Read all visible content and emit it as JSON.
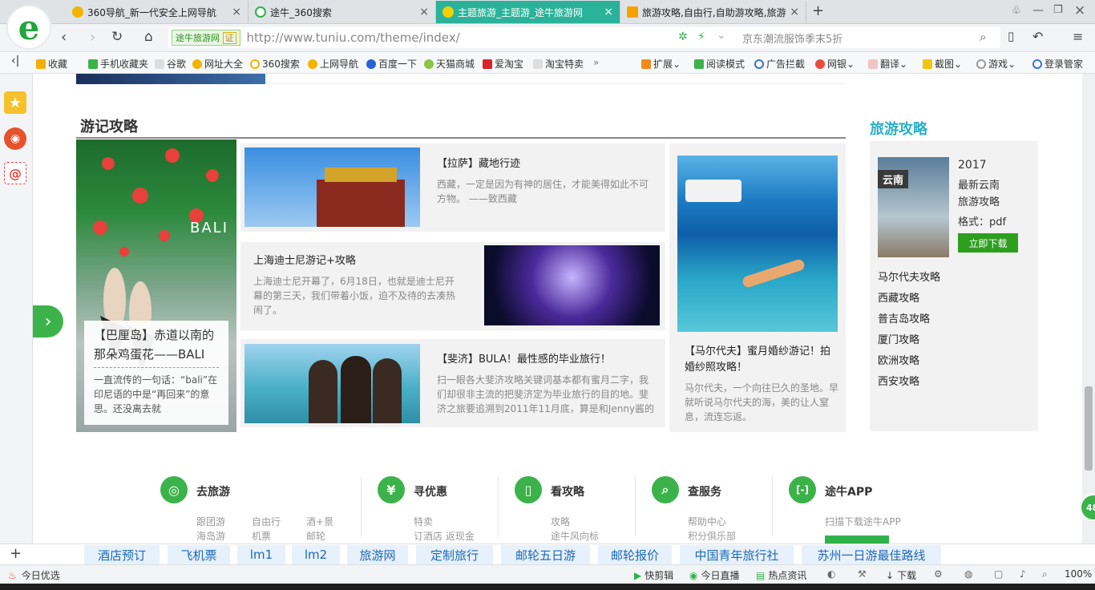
{
  "tabs": [
    {
      "label": "360导航_新一代安全上网导航",
      "color": "#f2b400"
    },
    {
      "label": "途牛_360搜索",
      "color": "#2fb24a"
    },
    {
      "label": "主题旅游_主题游_途牛旅游网",
      "color": "#f5d000"
    },
    {
      "label": "旅游攻略,自由行,自助游攻略,旅游",
      "color": "#f5a200"
    }
  ],
  "toolbar": {
    "site_badge": "途牛旅游网",
    "cert": "证",
    "url": "http://www.tuniu.com/theme/index/",
    "search_hint": "京东潮流服饰季末5折"
  },
  "bookmarks": {
    "left": [
      "收藏",
      "手机收藏夹",
      "谷歌",
      "网址大全",
      "360搜索",
      "上网导航",
      "百度一下",
      "天猫商城",
      "爱淘宝",
      "淘宝特卖"
    ],
    "more": "»",
    "right": [
      "扩展",
      "阅读模式",
      "广告拦截",
      "网银",
      "翻译",
      "截图",
      "游戏",
      "登录管家"
    ]
  },
  "section": {
    "title": "游记攻略"
  },
  "feature": {
    "title": "【巴厘岛】赤道以南的那朵鸡蛋花——BALI",
    "desc": "一直流传的一句话：“bali”在印尼语的中是“再回来”的意思。还没离去就",
    "overlay": "BALI"
  },
  "articles": [
    {
      "title": "【拉萨】藏地行迹",
      "desc": "西藏，一定是因为有神的居住，才能美得如此不可方物。 ——致西藏"
    },
    {
      "title": "上海迪士尼游记+攻略",
      "desc": "上海迪士尼开幕了，6月18日，也就是迪士尼开幕的第三天，我们带着小饭，迫不及待的去凑热闹了。"
    },
    {
      "title": "【斐济】BULA！最性感的毕业旅行！",
      "desc": "扫一眼各大斐济攻略关键词基本都有蜜月二字，我们却很非主流的把斐济定为毕业旅行的目的地。斐济之旅要追溯到2011年11月底，算是和Jenny酱的"
    }
  ],
  "side_article": {
    "title": "【马尔代夫】蜜月婚纱游记！拍婚纱照攻略！",
    "desc": "马尔代夫，一个向往已久的圣地。早就听说马尔代夫的海，美的让人窒息，流连忘返。"
  },
  "guides": {
    "title": "旅游攻略",
    "book": {
      "cover_label": "云南",
      "year": "2017",
      "name1": "最新云南",
      "name2": "旅游攻略",
      "format": "格式：pdf",
      "button": "立即下载"
    },
    "list": [
      "马尔代夫攻略",
      "西藏攻略",
      "普吉岛攻略",
      "厦门攻略",
      "欧洲攻略",
      "西安攻略"
    ]
  },
  "footer": [
    {
      "head": "去旅游",
      "icon": "◎",
      "items": [
        "跟团游",
        "自由行",
        "酒+景",
        "海岛游",
        "机票",
        "邮轮"
      ]
    },
    {
      "head": "寻优惠",
      "icon": "¥",
      "items": [
        "特卖",
        "订酒店 返现金"
      ]
    },
    {
      "head": "看攻略",
      "icon": "▯",
      "items": [
        "攻略",
        "途牛风向标"
      ]
    },
    {
      "head": "查服务",
      "icon": "⌕",
      "items": [
        "帮助中心",
        "积分俱乐部"
      ]
    },
    {
      "head": "途牛APP",
      "icon": "[-]",
      "items": [
        "扫描下载途牛APP"
      ]
    }
  ],
  "ad_links": [
    "酒店预订",
    "飞机票",
    "lm1",
    "lm2",
    "旅游网",
    "定制旅行",
    "邮轮五日游",
    "邮轮报价",
    "中国青年旅行社",
    "苏州一日游最佳路线"
  ],
  "status": {
    "left": "今日优选",
    "items": [
      "快剪辑",
      "今日直播",
      "热点资讯",
      "下载"
    ],
    "zoom": "100%",
    "badge": "48"
  }
}
